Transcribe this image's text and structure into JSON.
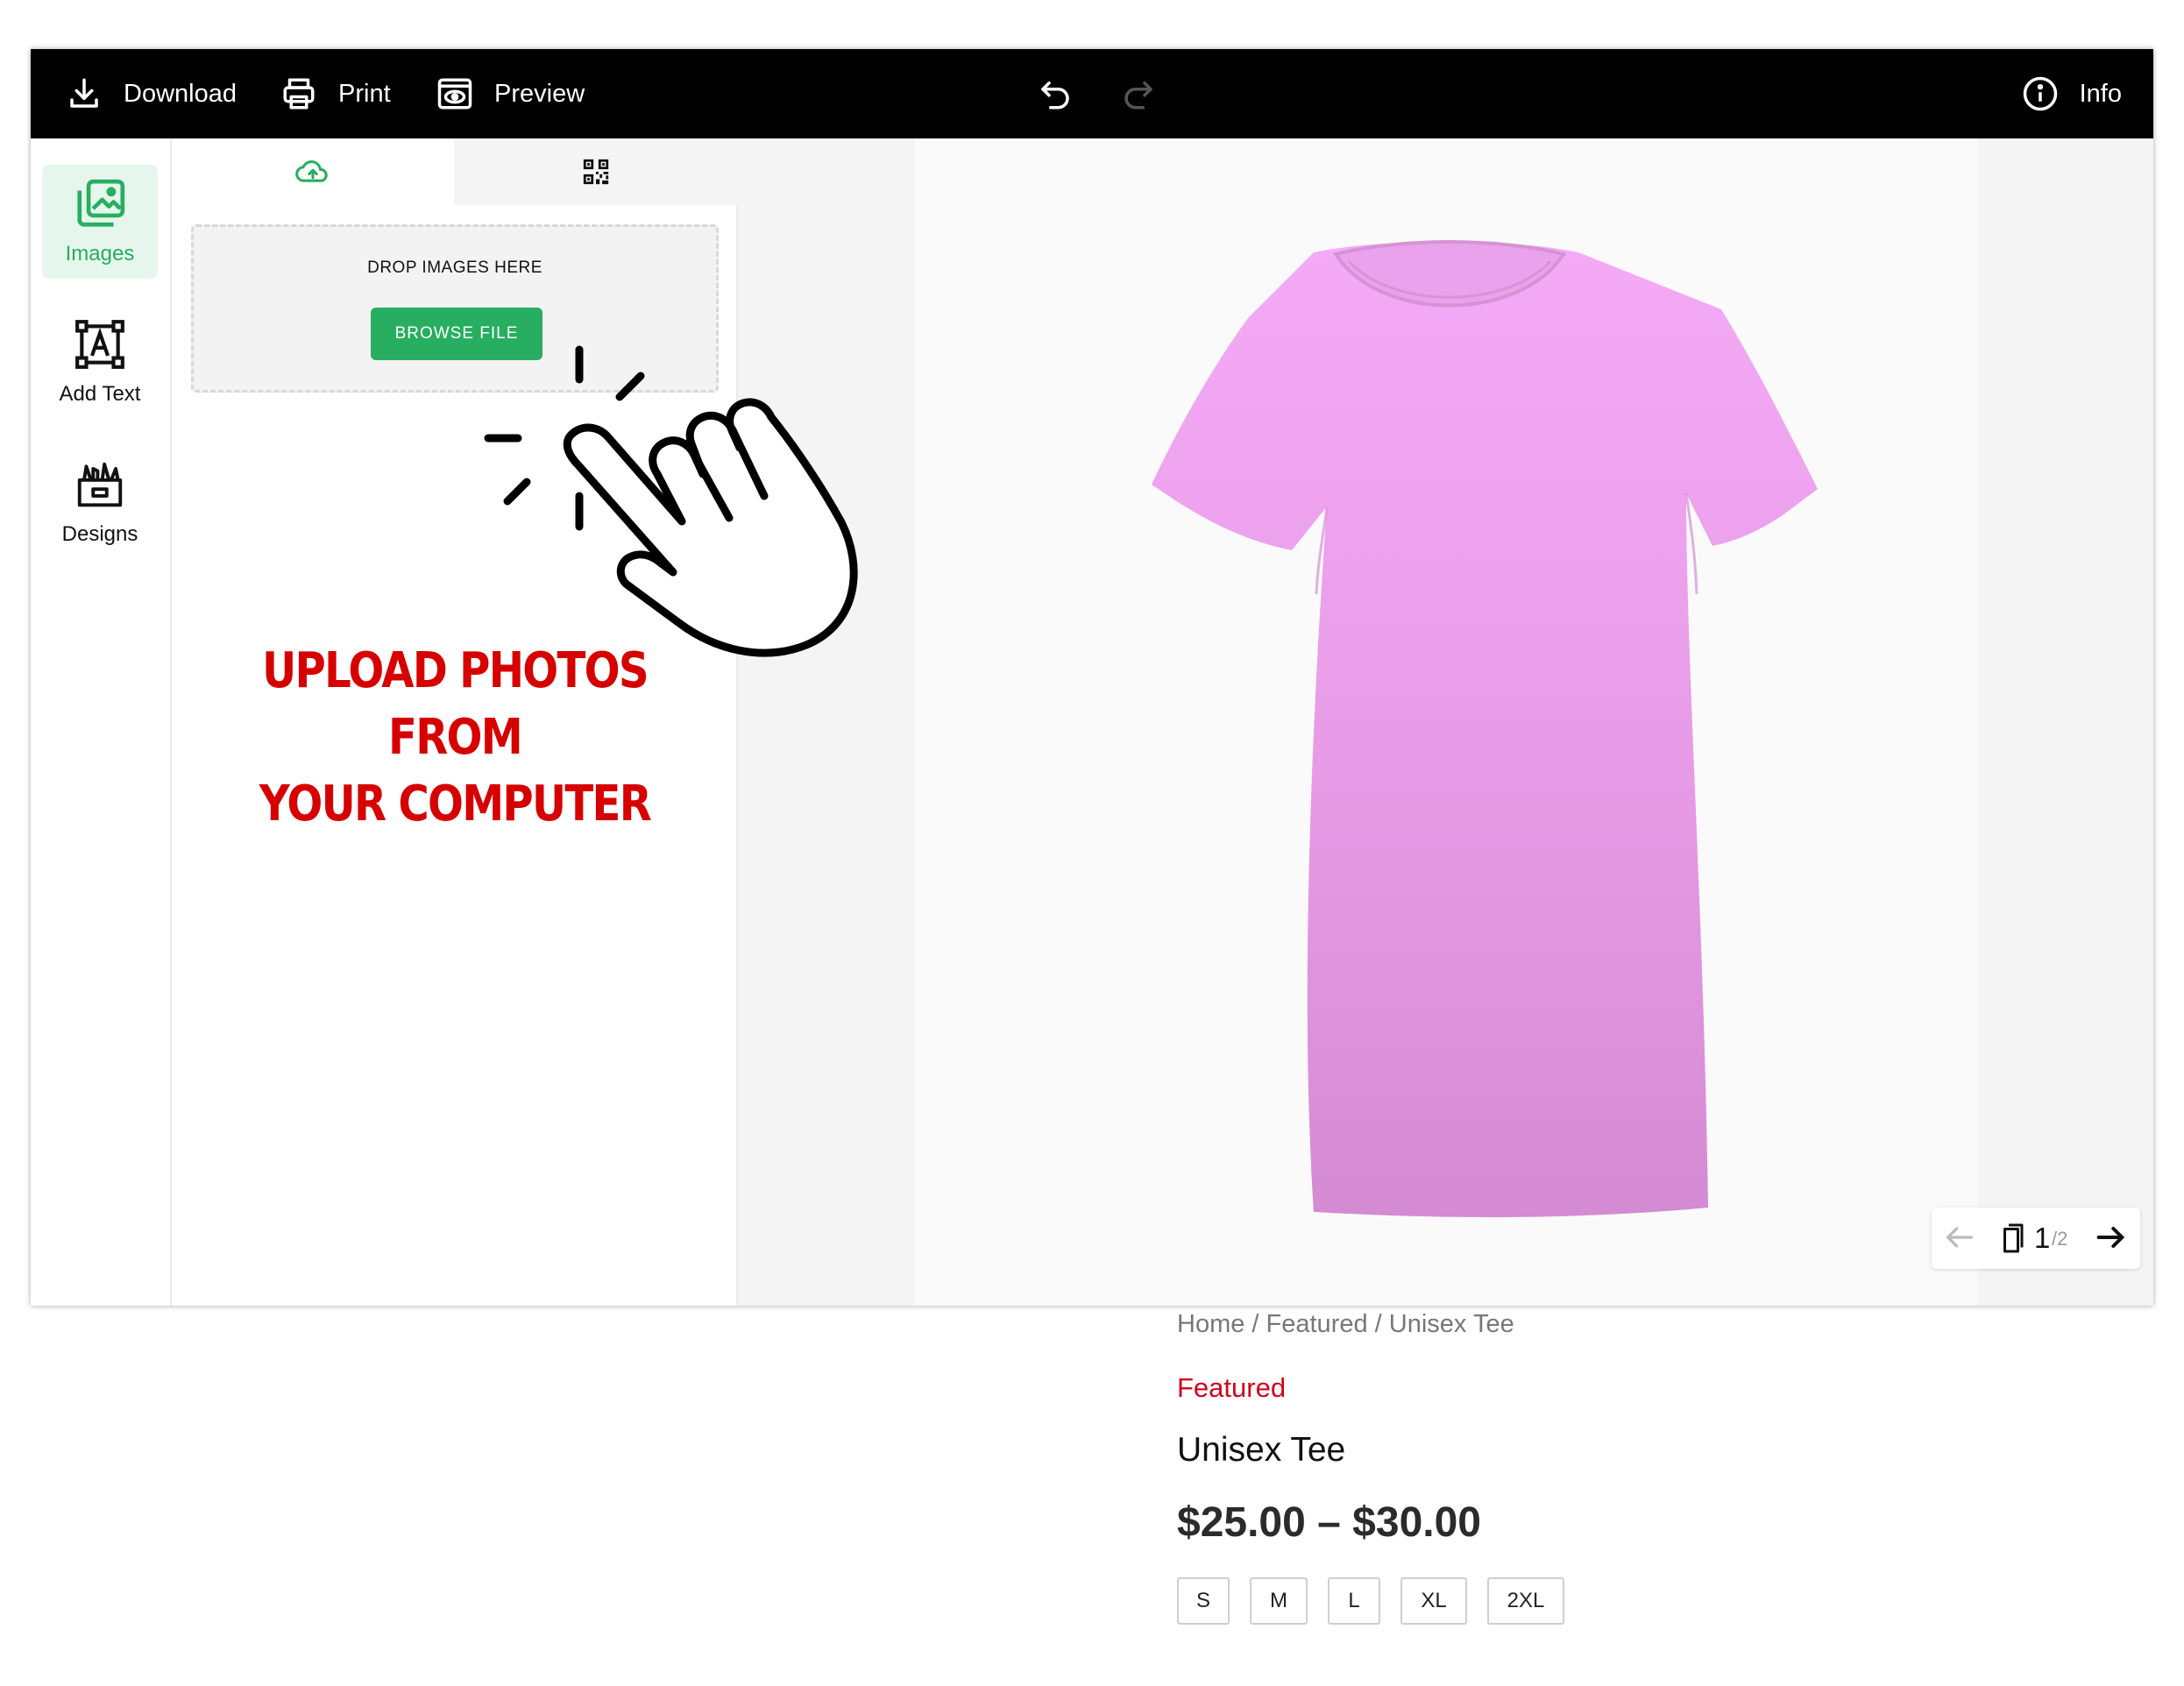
{
  "toolbar": {
    "download_label": "Download",
    "print_label": "Print",
    "preview_label": "Preview",
    "info_label": "Info"
  },
  "sidebar": {
    "items": [
      {
        "label": "Images",
        "icon": "images-icon",
        "active": true
      },
      {
        "label": "Add Text",
        "icon": "text-icon",
        "active": false
      },
      {
        "label": "Designs",
        "icon": "designs-icon",
        "active": false
      }
    ]
  },
  "upload_panel": {
    "tabs": [
      {
        "icon": "cloud-upload-icon",
        "active": true
      },
      {
        "icon": "qr-code-icon",
        "active": false
      }
    ],
    "drop_label": "DROP IMAGES HERE",
    "browse_label": "BROWSE FILE",
    "promo_line1": "UPLOAD PHOTOS FROM",
    "promo_line2": "YOUR COMPUTER"
  },
  "canvas": {
    "shirt_color": "#f2a6f3",
    "page_current": "1",
    "page_total": "/2"
  },
  "product": {
    "breadcrumb": [
      "Home",
      "Featured",
      "Unisex Tee"
    ],
    "breadcrumb_sep": " / ",
    "category": "Featured",
    "title": "Unisex Tee",
    "price": "$25.00 – $30.00",
    "sizes": [
      "S",
      "M",
      "L",
      "XL",
      "2XL"
    ]
  },
  "colors": {
    "accent_green": "#27ae60",
    "promo_red": "#d60000",
    "category_red": "#d0021b",
    "topbar_bg": "#000000"
  }
}
